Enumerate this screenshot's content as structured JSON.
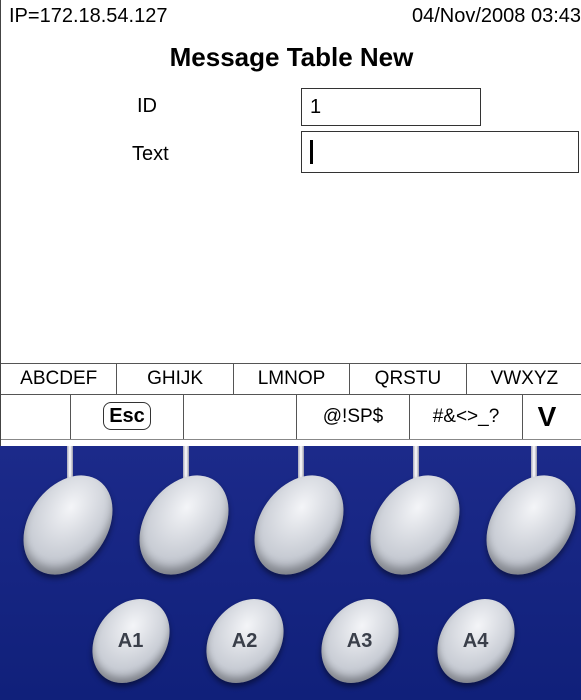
{
  "status": {
    "ip": "IP=172.18.54.127",
    "datetime": "04/Nov/2008 03:43"
  },
  "form": {
    "title": "Message Table New",
    "id_label": "ID",
    "id_value": "1",
    "text_label": "Text",
    "text_value": ""
  },
  "charsets": [
    "ABCDEF",
    "GHIJK",
    "LMNOP",
    "QRSTU",
    "VWXYZ"
  ],
  "softkeys": [
    "",
    "Esc",
    "",
    "@!SP$",
    "#&<>_?",
    "V"
  ],
  "keypad": {
    "alpha_keys": [
      "A1",
      "A2",
      "A3",
      "A4"
    ]
  },
  "colors": {
    "keypad_bg": "#16268a"
  }
}
